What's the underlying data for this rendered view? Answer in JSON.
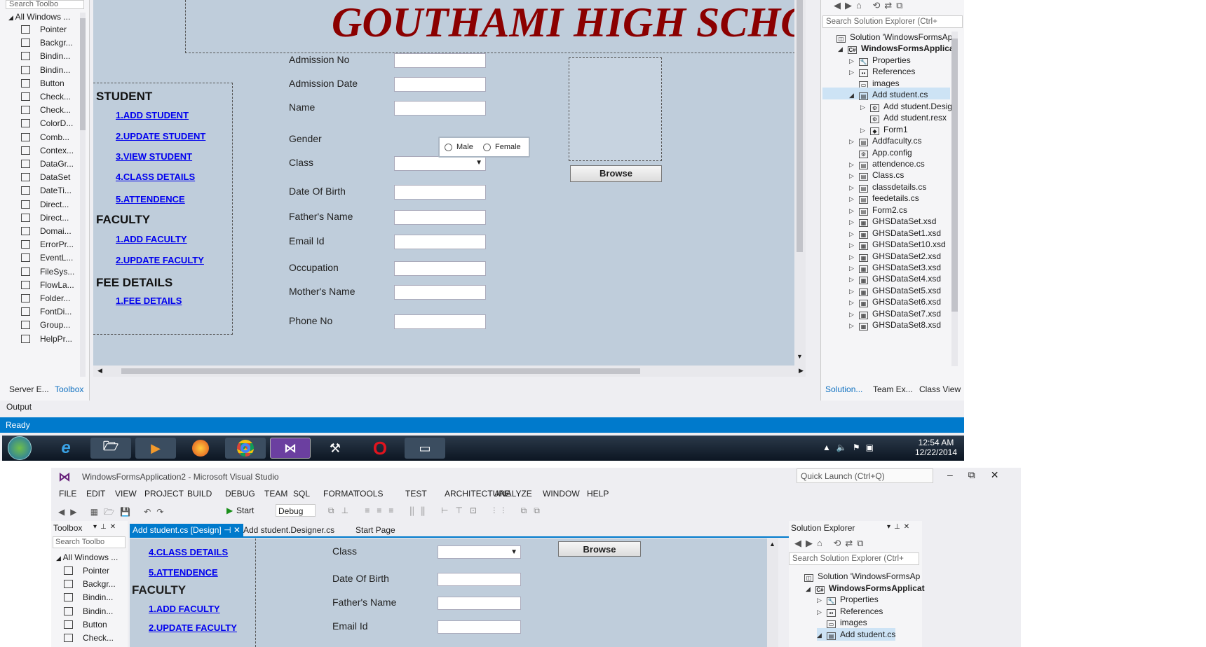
{
  "toolbox": {
    "search_placeholder": "Search Toolbo",
    "group": "All Windows ...",
    "items": [
      "Pointer",
      "Backgr...",
      "Bindin...",
      "Bindin...",
      "Button",
      "Check...",
      "Check...",
      "ColorD...",
      "Comb...",
      "Contex...",
      "DataGr...",
      "DataSet",
      "DateTi...",
      "Direct...",
      "Direct...",
      "Domai...",
      "ErrorPr...",
      "EventL...",
      "FileSys...",
      "FlowLa...",
      "Folder...",
      "FontDi...",
      "Group...",
      "HelpPr..."
    ],
    "bottom_tabs": [
      "Server E...",
      "Toolbox"
    ]
  },
  "form": {
    "title": "GOUTHAMI HIGH SCHO",
    "nav": {
      "student_heading": "STUDENT",
      "student_links": [
        "1.ADD STUDENT",
        "2.UPDATE STUDENT",
        "3.VIEW STUDENT",
        "4.CLASS DETAILS",
        "5.ATTENDENCE"
      ],
      "faculty_heading": "FACULTY",
      "faculty_links": [
        "1.ADD FACULTY",
        "2.UPDATE FACULTY"
      ],
      "fee_heading": "FEE DETAILS",
      "fee_links": [
        "1.FEE DETAILS"
      ]
    },
    "labels": [
      "Admission No",
      "Admission Date",
      "Name",
      "Gender",
      "Class",
      "Date Of Birth",
      "Father's Name",
      "Email Id",
      "Occupation",
      "Mother's Name",
      "Phone No"
    ],
    "gender_options": [
      "Male",
      "Female"
    ],
    "browse": "Browse"
  },
  "output_tab": "Output",
  "status": "Ready",
  "solution_explorer": {
    "search_placeholder": "Search Solution Explorer (Ctrl+",
    "items": [
      {
        "label": "Solution 'WindowsFormsAp",
        "indent": 0,
        "arrow": "",
        "icon": "sln"
      },
      {
        "label": "WindowsFormsApplicat",
        "indent": 1,
        "arrow": "◢",
        "icon": "C#",
        "bold": true
      },
      {
        "label": "Properties",
        "indent": 2,
        "arrow": "▷",
        "icon": "wrench"
      },
      {
        "label": "References",
        "indent": 2,
        "arrow": "▷",
        "icon": "ref"
      },
      {
        "label": "images",
        "indent": 2,
        "arrow": "",
        "icon": "folder"
      },
      {
        "label": "Add student.cs",
        "indent": 2,
        "arrow": "◢",
        "icon": "form",
        "selected": true
      },
      {
        "label": "Add student.Desig",
        "indent": 3,
        "arrow": "▷",
        "icon": "cs"
      },
      {
        "label": "Add student.resx",
        "indent": 3,
        "arrow": "",
        "icon": "resx"
      },
      {
        "label": "Form1",
        "indent": 3,
        "arrow": "▷",
        "icon": "form1"
      },
      {
        "label": "Addfaculty.cs",
        "indent": 2,
        "arrow": "▷",
        "icon": "form"
      },
      {
        "label": "App.config",
        "indent": 2,
        "arrow": "",
        "icon": "cfg"
      },
      {
        "label": "attendence.cs",
        "indent": 2,
        "arrow": "▷",
        "icon": "form"
      },
      {
        "label": "Class.cs",
        "indent": 2,
        "arrow": "▷",
        "icon": "form"
      },
      {
        "label": "classdetails.cs",
        "indent": 2,
        "arrow": "▷",
        "icon": "form"
      },
      {
        "label": "feedetails.cs",
        "indent": 2,
        "arrow": "▷",
        "icon": "form"
      },
      {
        "label": "Form2.cs",
        "indent": 2,
        "arrow": "▷",
        "icon": "form"
      },
      {
        "label": "GHSDataSet.xsd",
        "indent": 2,
        "arrow": "▷",
        "icon": "xsd"
      },
      {
        "label": "GHSDataSet1.xsd",
        "indent": 2,
        "arrow": "▷",
        "icon": "xsd"
      },
      {
        "label": "GHSDataSet10.xsd",
        "indent": 2,
        "arrow": "▷",
        "icon": "xsd"
      },
      {
        "label": "GHSDataSet2.xsd",
        "indent": 2,
        "arrow": "▷",
        "icon": "xsd"
      },
      {
        "label": "GHSDataSet3.xsd",
        "indent": 2,
        "arrow": "▷",
        "icon": "xsd"
      },
      {
        "label": "GHSDataSet4.xsd",
        "indent": 2,
        "arrow": "▷",
        "icon": "xsd"
      },
      {
        "label": "GHSDataSet5.xsd",
        "indent": 2,
        "arrow": "▷",
        "icon": "xsd"
      },
      {
        "label": "GHSDataSet6.xsd",
        "indent": 2,
        "arrow": "▷",
        "icon": "xsd"
      },
      {
        "label": "GHSDataSet7.xsd",
        "indent": 2,
        "arrow": "▷",
        "icon": "xsd"
      },
      {
        "label": "GHSDataSet8.xsd",
        "indent": 2,
        "arrow": "▷",
        "icon": "xsd"
      }
    ],
    "bottom_tabs": [
      "Solution...",
      "Team Ex...",
      "Class View"
    ]
  },
  "taskbar": {
    "time": "12:54 AM",
    "date": "12/22/2014"
  },
  "vs2": {
    "title": "WindowsFormsApplication2 - Microsoft Visual Studio",
    "quick_launch": "Quick Launch (Ctrl+Q)",
    "menu": [
      "FILE",
      "EDIT",
      "VIEW",
      "PROJECT",
      "BUILD",
      "DEBUG",
      "TEAM",
      "SQL",
      "FORMAT",
      "TOOLS",
      "TEST",
      "ARCHITECTURE",
      "ANALYZE",
      "WINDOW",
      "HELP"
    ],
    "start": "Start",
    "config": "Debug",
    "toolbox_title": "Toolbox",
    "tabs": [
      "Add student.cs [Design]",
      "Add student.Designer.cs",
      "Start Page"
    ],
    "toolbox_group": "All Windows ...",
    "toolbox_items": [
      "Pointer",
      "Backgr...",
      "Bindin...",
      "Bindin...",
      "Button",
      "Check..."
    ],
    "nav_links_top": [
      "4.CLASS DETAILS",
      "5.ATTENDENCE"
    ],
    "faculty_heading": "FACULTY",
    "faculty_links": [
      "1.ADD FACULTY",
      "2.UPDATE FACULTY"
    ],
    "labels": [
      "Class",
      "Date Of Birth",
      "Father's Name",
      "Email Id"
    ],
    "browse": "Browse",
    "se_title": "Solution Explorer",
    "se_search": "Search Solution Explorer (Ctrl+",
    "se_items": [
      "Solution 'WindowsFormsAp",
      "WindowsFormsApplicat",
      "Properties",
      "References",
      "images",
      "Add student.cs"
    ]
  },
  "colors": {
    "title_red": "#8b0000",
    "design_bg": "#bfcddb",
    "status_blue": "#007acc",
    "link": "#0000ee"
  }
}
